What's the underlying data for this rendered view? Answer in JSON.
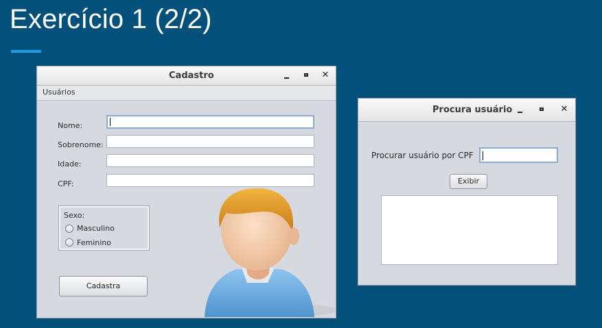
{
  "slide": {
    "title": "Exercício 1 (2/2)"
  },
  "cadastro_window": {
    "title": "Cadastro",
    "menu": [
      "Usuários"
    ],
    "fields": [
      {
        "label": "Nome:",
        "value": ""
      },
      {
        "label": "Sobrenome:",
        "value": ""
      },
      {
        "label": "Idade:",
        "value": ""
      },
      {
        "label": "CPF:",
        "value": ""
      }
    ],
    "sexo_group": {
      "label": "Sexo:",
      "options": [
        "Masculino",
        "Feminino"
      ]
    },
    "submit_label": "Cadastra",
    "avatar_icon": "user-avatar-icon"
  },
  "procura_window": {
    "title": "Procura usuário",
    "search_label": "Procurar usuário por CPF",
    "search_value": "",
    "button_label": "Exibir",
    "result_text": ""
  },
  "colors": {
    "slide_background": "#03507a",
    "accent": "#1e9be6",
    "window_background": "#d6d9df"
  }
}
